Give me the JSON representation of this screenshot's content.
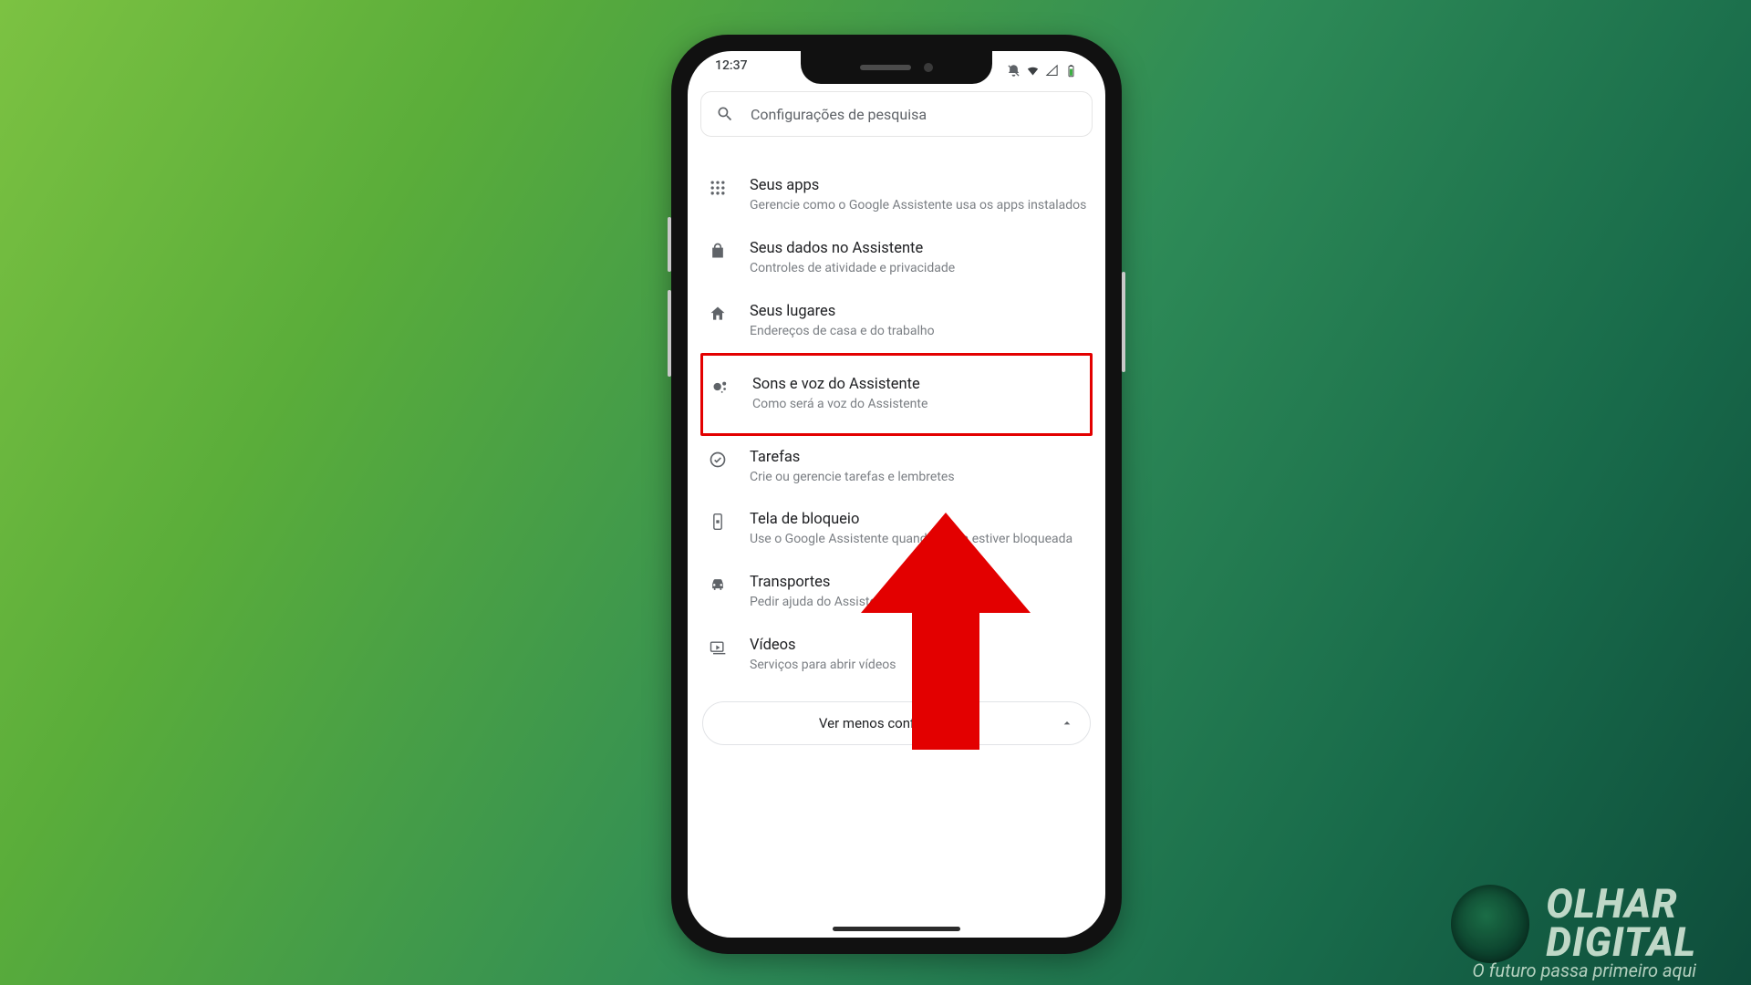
{
  "statusbar": {
    "time": "12:37"
  },
  "search": {
    "placeholder": "Configurações de pesquisa"
  },
  "items": [
    {
      "title": "Seus apps",
      "subtitle": "Gerencie como o Google Assistente usa os apps instalados"
    },
    {
      "title": "Seus dados no Assistente",
      "subtitle": "Controles de atividade e privacidade"
    },
    {
      "title": "Seus lugares",
      "subtitle": "Endereços de casa e do trabalho"
    },
    {
      "title": "Sons e voz do Assistente",
      "subtitle": "Como será a voz do Assistente"
    },
    {
      "title": "Tarefas",
      "subtitle": "Crie ou gerencie tarefas e lembretes"
    },
    {
      "title": "Tela de bloqueio",
      "subtitle": "Use o Google Assistente quando a tela estiver bloqueada"
    },
    {
      "title": "Transportes",
      "subtitle": "Pedir ajuda do Assistente com trajetos"
    },
    {
      "title": "Vídeos",
      "subtitle": "Serviços para abrir vídeos"
    }
  ],
  "footer": {
    "label": "Ver menos configurações"
  },
  "highlight_index": 3,
  "brand": {
    "line1": "OLHAR",
    "line2": "DIGITAL",
    "tagline": "O futuro passa primeiro aqui"
  },
  "annotation": {
    "highlight_color": "#e30000",
    "arrow_color": "#e30000"
  }
}
